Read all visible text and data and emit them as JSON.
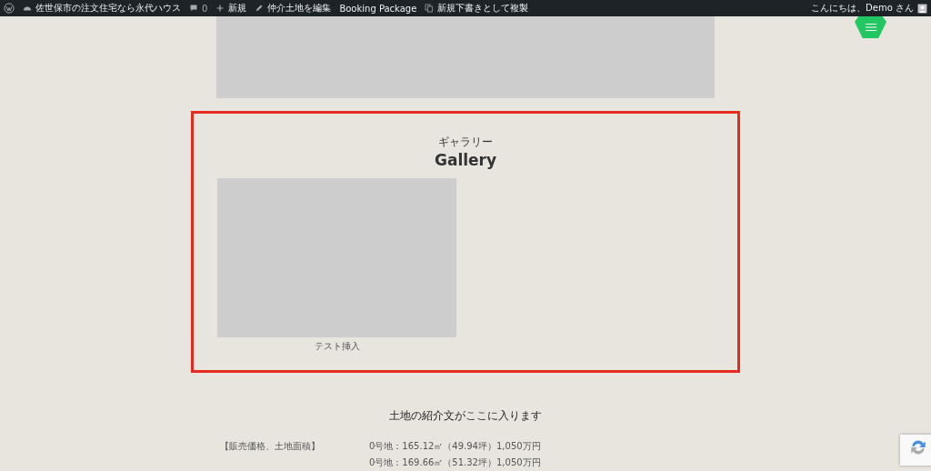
{
  "admin_bar": {
    "site_name": "佐世保市の注文住宅なら永代ハウス",
    "comments_count": "0",
    "new_label": "新規",
    "edit_label": "仲介土地を編集",
    "plugin_label": "Booking Package",
    "duplicate_label": "新規下書きとして複製",
    "greeting": "こんにちは、Demo さん"
  },
  "gallery": {
    "kicker": "ギャラリー",
    "title": "Gallery",
    "items": [
      {
        "kind": "picture",
        "caption": "テスト挿入"
      }
    ]
  },
  "intro": "土地の紹介文がここに入ります",
  "details": [
    {
      "label": "【販売価格、土地面積】",
      "value": "0号地：165.12㎡（49.94坪）1,050万円"
    },
    {
      "value": "0号地：169.66㎡（51.32坪）1,050万円"
    }
  ]
}
